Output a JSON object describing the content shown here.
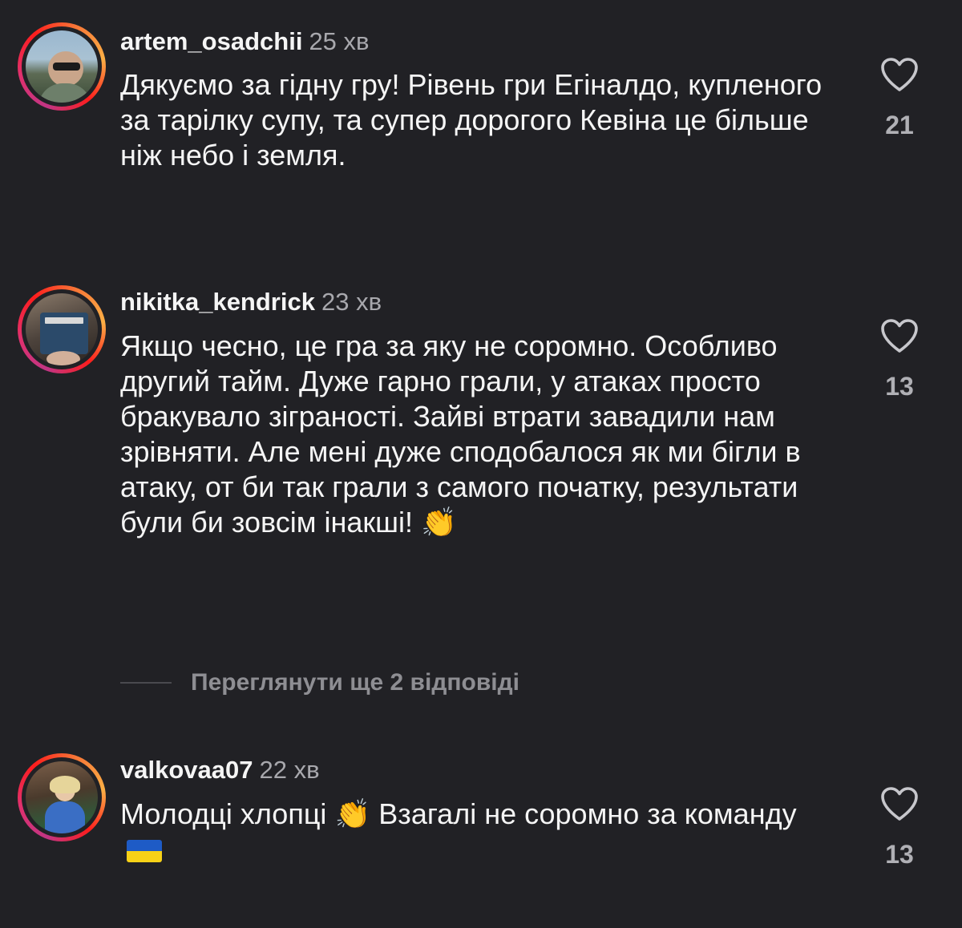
{
  "comments": [
    {
      "username": "artem_osadchii",
      "time": "25 хв",
      "text": "Дякуємо за гідну гру! Рівень гри Егіналдо, купленого за тарілку супу, та супер дорогого Кевіна це більше ніж небо і земля.",
      "likes": "21",
      "icon": "heart-outline-icon"
    },
    {
      "username": "nikitka_kendrick",
      "time": "23 хв",
      "text": "Якщо чесно, це гра за яку не соромно. Особливо другий тайм. Дуже гарно грали, у атаках просто бракувало зіграності. Зайві втрати завадили нам зрівняти. Але мені дуже сподобалося як ми бігли в атаку, от би так грали з самого початку, результати були би зовсім інакші!",
      "emoji": "👏",
      "likes": "13",
      "icon": "heart-outline-icon"
    },
    {
      "username": "valkovaa07",
      "time": "22 хв",
      "text_part1": "Молодці хлопці",
      "emoji": "👏",
      "text_part2": "Взагалі не соромно за команду",
      "likes": "13",
      "icon": "heart-outline-icon"
    }
  ],
  "view_replies": "Переглянути ще 2 відповіді",
  "colors": {
    "background": "#212125",
    "text": "#f5f5f5",
    "muted": "#a8a8ad"
  }
}
